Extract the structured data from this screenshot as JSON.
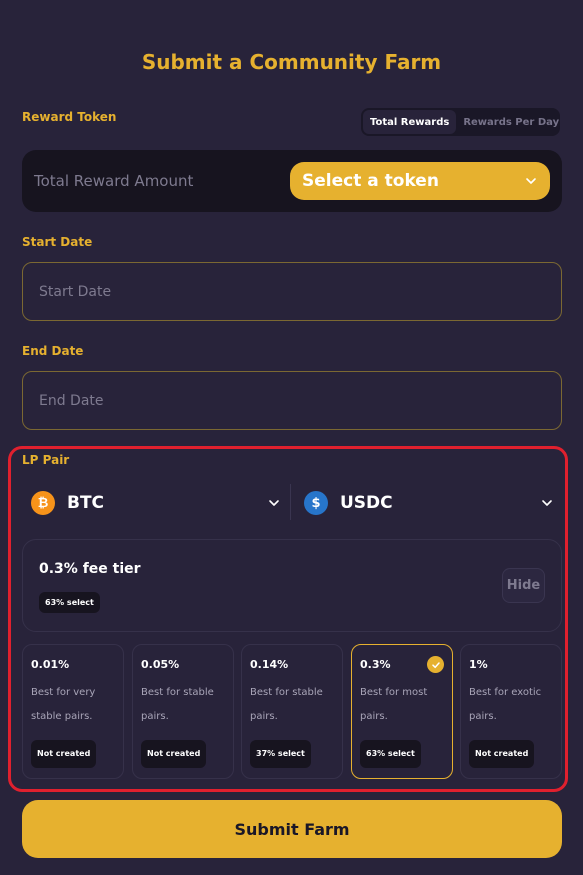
{
  "title": "Submit a Community Farm",
  "reward": {
    "label": "Reward Token",
    "toggle": [
      "Total Rewards",
      "Rewards Per Day"
    ],
    "amount_placeholder": "Total Reward Amount",
    "select_token_label": "Select a token"
  },
  "start_date": {
    "label": "Start Date",
    "placeholder": "Start Date"
  },
  "end_date": {
    "label": "End Date",
    "placeholder": "End Date"
  },
  "lp_pair": {
    "label": "LP Pair",
    "token_a": {
      "symbol": "BTC",
      "icon": "bitcoin-icon",
      "color": "#f7931a",
      "glyph": "₿"
    },
    "token_b": {
      "symbol": "USDC",
      "icon": "usdc-icon",
      "color": "#2775ca",
      "glyph": "$"
    },
    "fee_summary": {
      "title": "0.3% fee tier",
      "badge": "63% select",
      "hide_label": "Hide"
    },
    "tiers": [
      {
        "pct": "0.01%",
        "desc": "Best for very stable pairs.",
        "badge": "Not created",
        "selected": false
      },
      {
        "pct": "0.05%",
        "desc": "Best for stable pairs.",
        "badge": "Not created",
        "selected": false
      },
      {
        "pct": "0.14%",
        "desc": "Best for stable pairs.",
        "badge": "37% select",
        "selected": false
      },
      {
        "pct": "0.3%",
        "desc": "Best for most pairs.",
        "badge": "63% select",
        "selected": true
      },
      {
        "pct": "1%",
        "desc": "Best for exotic pairs.",
        "badge": "Not created",
        "selected": false
      }
    ]
  },
  "submit_label": "Submit Farm",
  "colors": {
    "accent": "#e6b12f",
    "background": "#28233a",
    "highlight_border": "#e0202e"
  }
}
